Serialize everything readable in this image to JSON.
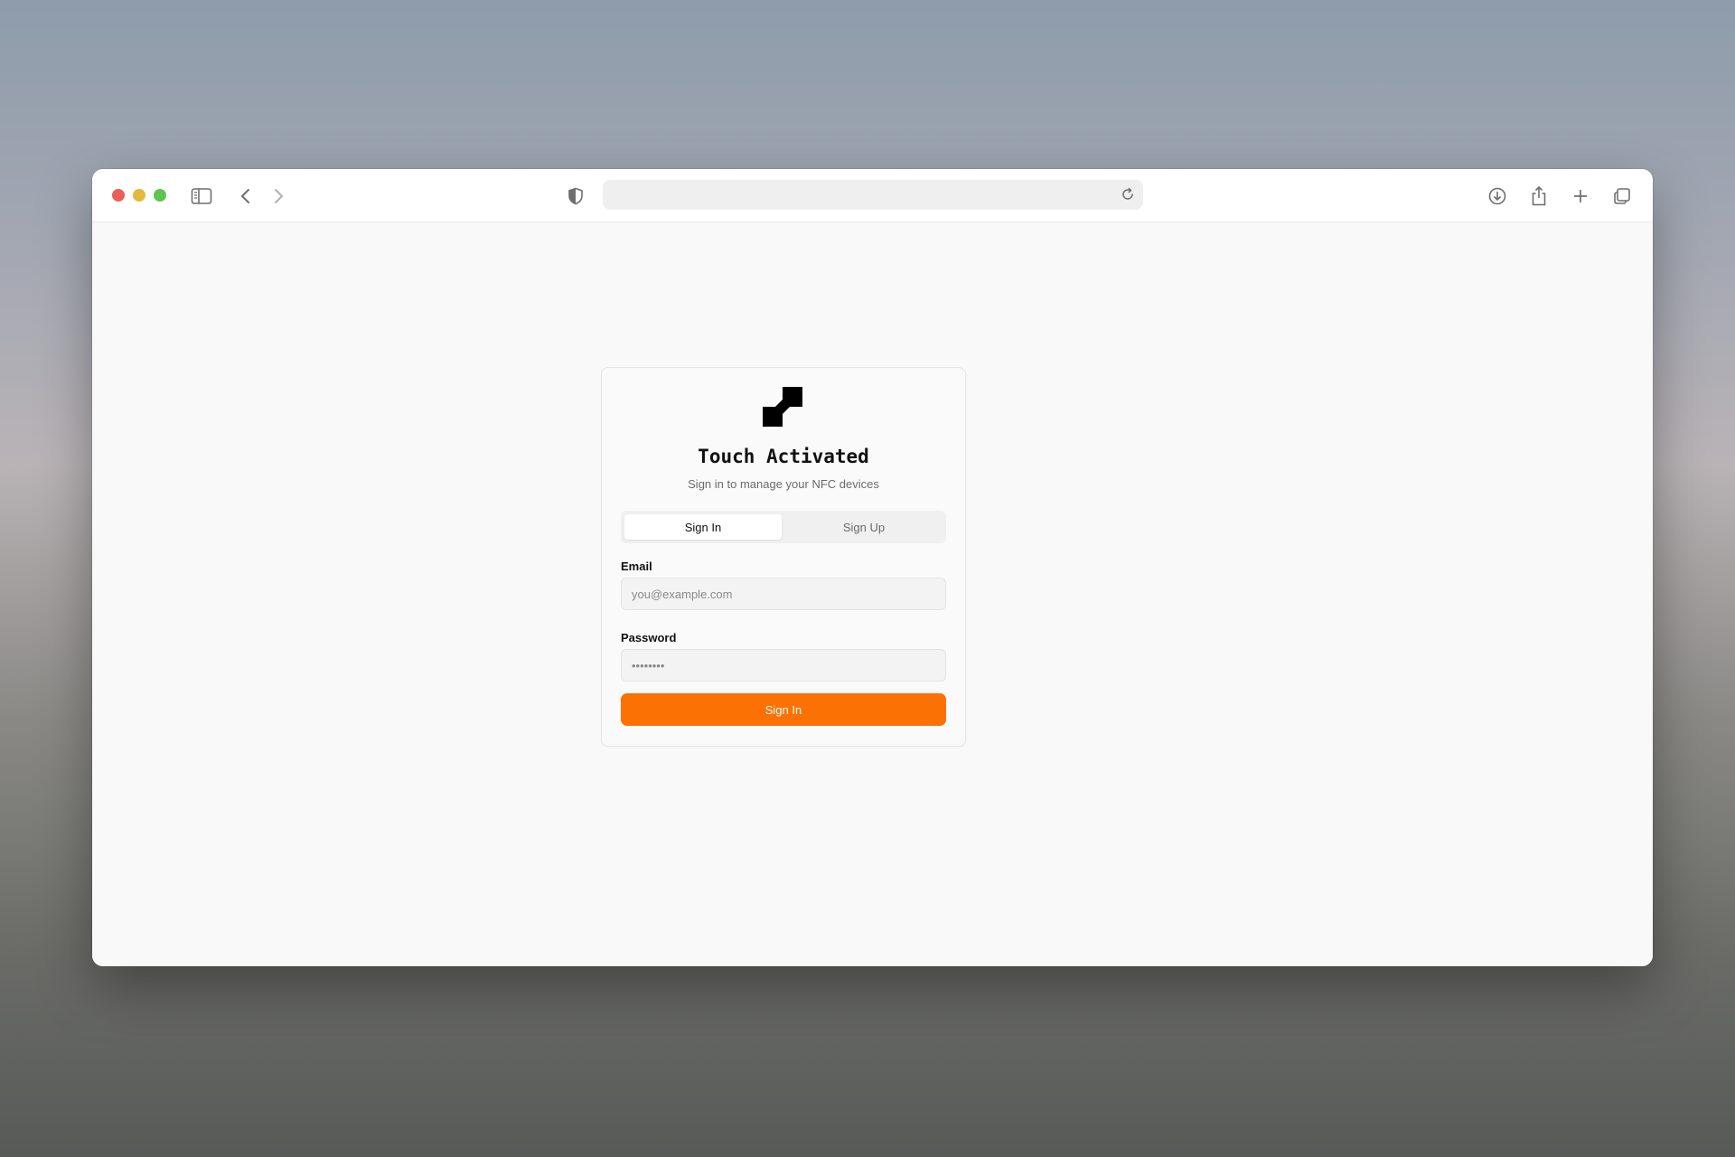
{
  "browser": {
    "window_controls": [
      "close",
      "minimize",
      "maximize"
    ],
    "toolbar_icons": [
      "sidebar-icon",
      "back-icon",
      "forward-icon",
      "shield-icon",
      "reload-icon",
      "download-icon",
      "share-icon",
      "new-tab-icon",
      "tabs-overview-icon"
    ],
    "address": ""
  },
  "auth": {
    "logo": "touch-activated-logo",
    "title": "Touch Activated",
    "subtitle": "Sign in to manage your NFC devices",
    "tabs": [
      {
        "label": "Sign In",
        "active": true
      },
      {
        "label": "Sign Up",
        "active": false
      }
    ],
    "email": {
      "label": "Email",
      "placeholder": "you@example.com",
      "value": ""
    },
    "password": {
      "label": "Password",
      "placeholder": "••••••••",
      "value": ""
    },
    "submit_label": "Sign In"
  },
  "colors": {
    "accent": "#fb7103",
    "close": "#ec5f57",
    "minimize": "#e5b93f",
    "maximize": "#5fc451"
  }
}
